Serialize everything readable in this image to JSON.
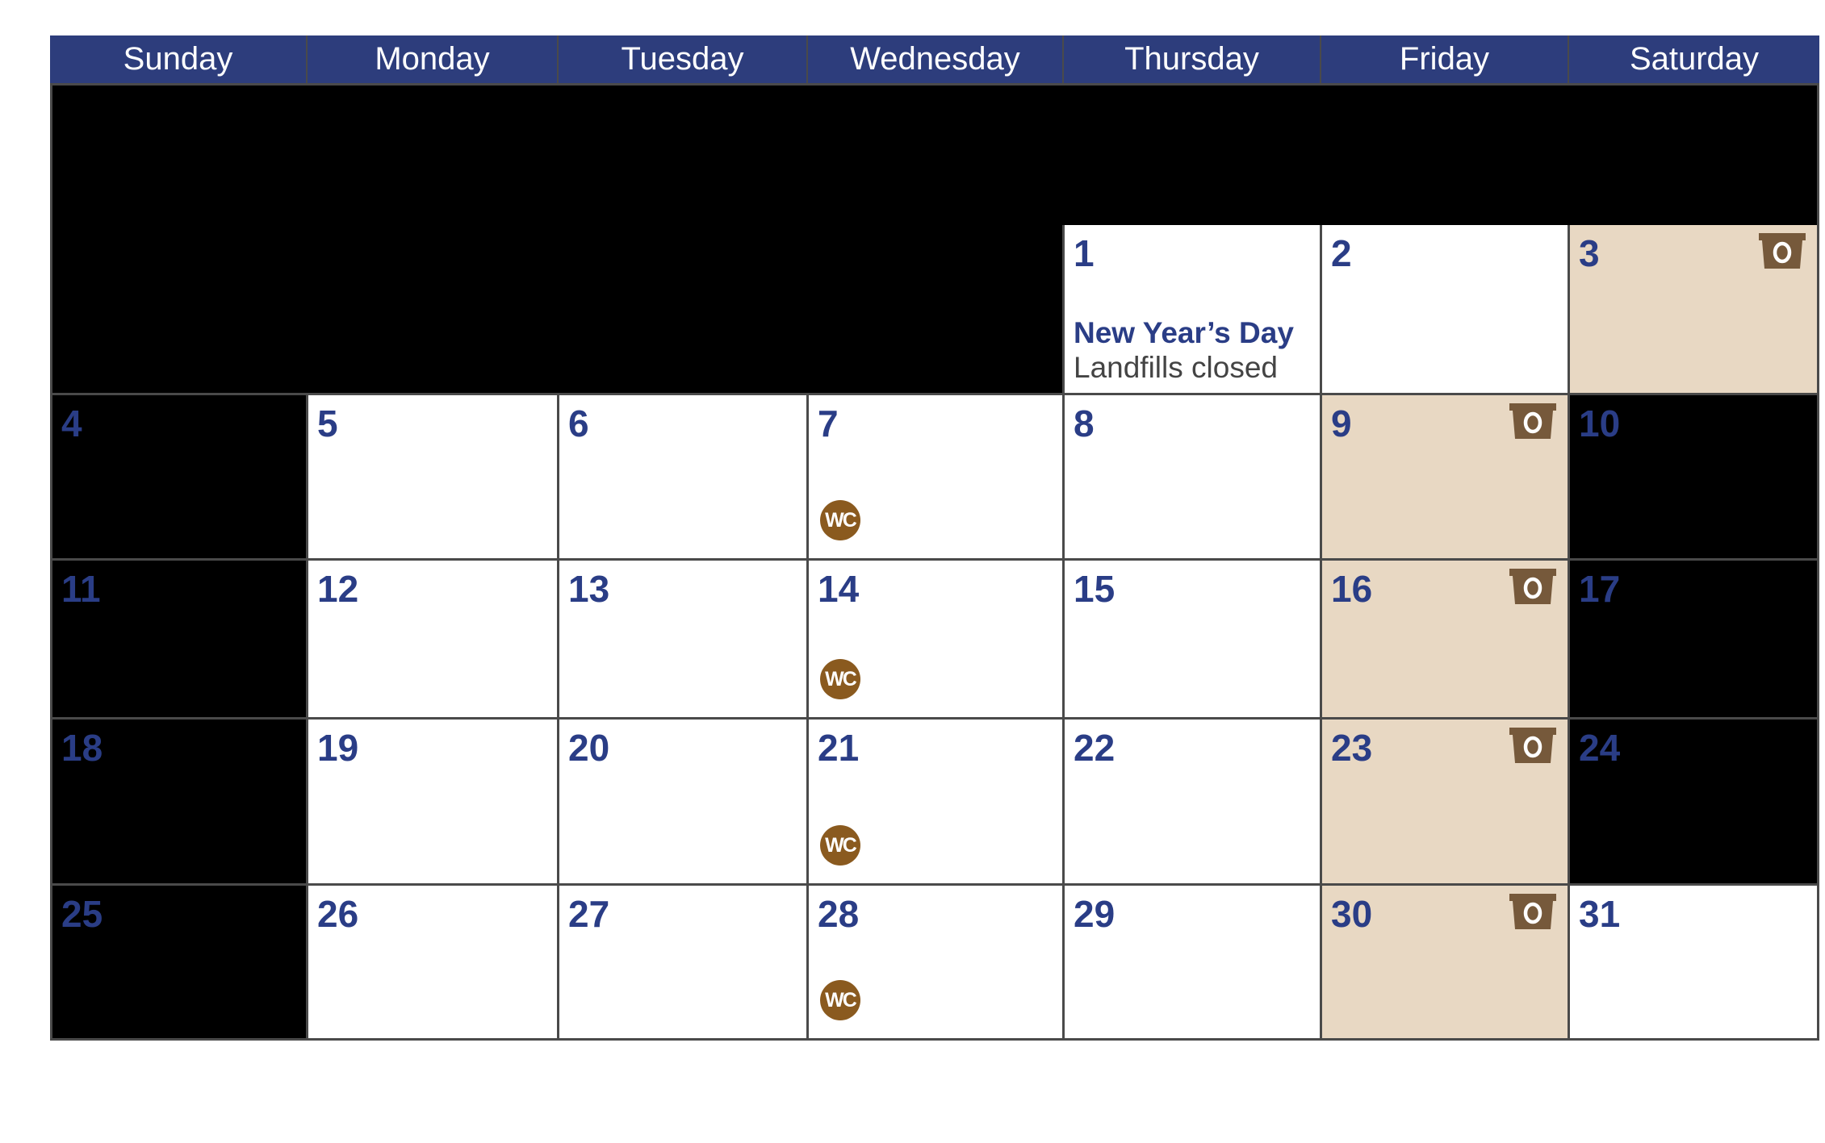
{
  "calendar": {
    "weekdays": [
      "Sunday",
      "Monday",
      "Tuesday",
      "Wednesday",
      "Thursday",
      "Friday",
      "Saturday"
    ],
    "colors": {
      "header": "#2d3d7c",
      "day_number": "#2a3d86",
      "collection_day": "#e8d8c3",
      "organics_icon": "#76593b",
      "wc_badge": "#8a5a1f",
      "grid_line": "#4a4a4a"
    },
    "legend_icons": {
      "organics": {
        "icon": "organics-bin-icon",
        "glyph": "O"
      },
      "wc": {
        "icon": "wc-badge-icon",
        "label": "WC"
      }
    },
    "weeks": [
      [
        {
          "day": null,
          "style": "black"
        },
        {
          "day": null,
          "style": "black"
        },
        {
          "day": null,
          "style": "black"
        },
        {
          "day": null,
          "style": "black"
        },
        {
          "day": null,
          "style": "black"
        },
        {
          "day": null,
          "style": "black"
        },
        {
          "day": null,
          "style": "black"
        }
      ],
      [
        {
          "day": null,
          "style": "black"
        },
        {
          "day": null,
          "style": "black"
        },
        {
          "day": null,
          "style": "black"
        },
        {
          "day": null,
          "style": "black"
        },
        {
          "day": "1",
          "style": "white",
          "holiday": "New Year’s Day",
          "note": "Landfills closed"
        },
        {
          "day": "2",
          "style": "white"
        },
        {
          "day": "3",
          "style": "beige",
          "organics": true
        }
      ],
      [
        {
          "day": "4",
          "style": "black"
        },
        {
          "day": "5",
          "style": "white"
        },
        {
          "day": "6",
          "style": "white"
        },
        {
          "day": "7",
          "style": "white",
          "wc": true
        },
        {
          "day": "8",
          "style": "white"
        },
        {
          "day": "9",
          "style": "beige",
          "organics": true
        },
        {
          "day": "10",
          "style": "black"
        }
      ],
      [
        {
          "day": "11",
          "style": "black"
        },
        {
          "day": "12",
          "style": "white"
        },
        {
          "day": "13",
          "style": "white"
        },
        {
          "day": "14",
          "style": "white",
          "wc": true
        },
        {
          "day": "15",
          "style": "white"
        },
        {
          "day": "16",
          "style": "beige",
          "organics": true
        },
        {
          "day": "17",
          "style": "black"
        }
      ],
      [
        {
          "day": "18",
          "style": "black"
        },
        {
          "day": "19",
          "style": "white"
        },
        {
          "day": "20",
          "style": "white"
        },
        {
          "day": "21",
          "style": "white",
          "wc": true
        },
        {
          "day": "22",
          "style": "white"
        },
        {
          "day": "23",
          "style": "beige",
          "organics": true
        },
        {
          "day": "24",
          "style": "black"
        }
      ],
      [
        {
          "day": "25",
          "style": "black"
        },
        {
          "day": "26",
          "style": "white"
        },
        {
          "day": "27",
          "style": "white"
        },
        {
          "day": "28",
          "style": "white",
          "wc": true
        },
        {
          "day": "29",
          "style": "white"
        },
        {
          "day": "30",
          "style": "beige",
          "organics": true
        },
        {
          "day": "31",
          "style": "white"
        }
      ]
    ]
  }
}
